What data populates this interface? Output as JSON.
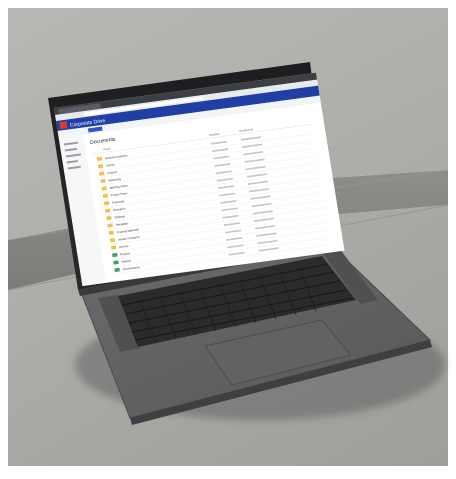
{
  "photo": {
    "subject": "laptop on concrete steps showing a file browser"
  },
  "screen": {
    "app_bar_title": "Corporate Drive",
    "breadcrumb": "Documents",
    "columns": [
      "Name",
      "Modified",
      "Modified By"
    ],
    "folders": [
      "Business Analysis",
      "Clients",
      "Finance",
      "Marketing",
      "Meeting Notes",
      "Project Plans",
      "Proposals",
      "Research",
      "Strategy",
      "Templates",
      "Training Materials",
      "Vendor Contracts",
      "Archive",
      "Reports",
      "Policies",
      "Presentations"
    ],
    "colors": {
      "app_bar": "#1f3fa5",
      "folder": "#f2c14e",
      "accent": "#2b57c9"
    }
  }
}
